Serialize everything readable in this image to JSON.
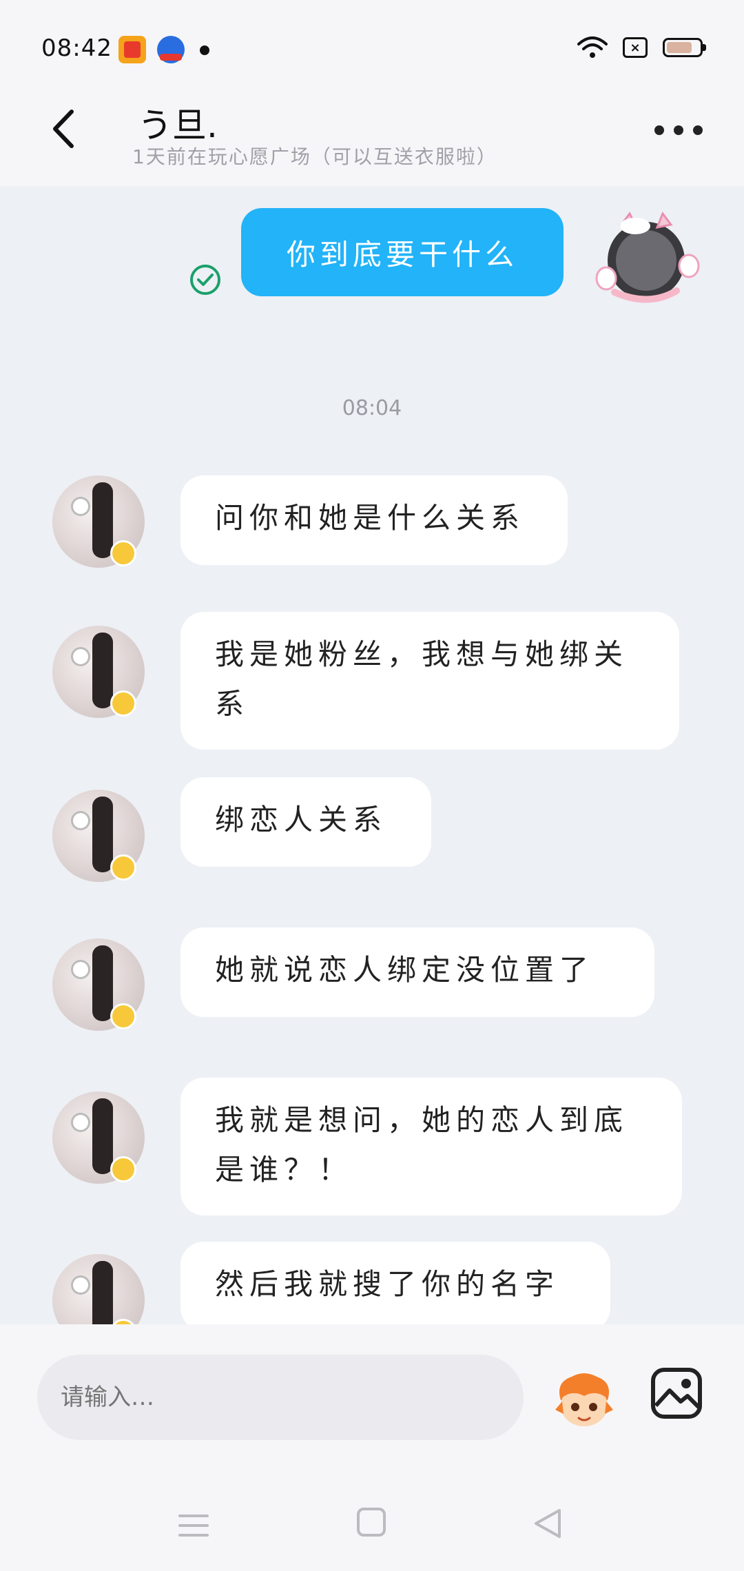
{
  "status_bar": {
    "time": "08:42"
  },
  "header": {
    "title": "う旦.",
    "subtitle": "1天前在玩心愿广场（可以互送衣服啦）"
  },
  "messages_out": [
    {
      "text": "你到底要干什么"
    }
  ],
  "timestamp": "08:04",
  "messages_in": [
    {
      "text": "问你和她是什么关系"
    },
    {
      "text": "我是她粉丝，我想与她绑关系"
    },
    {
      "text": "绑恋人关系"
    },
    {
      "text": "她就说恋人绑定没位置了"
    },
    {
      "text": "我就是想问，她的恋人到底是谁？！"
    },
    {
      "text": "然后我就搜了你的名字"
    }
  ],
  "input": {
    "placeholder": "请输入…"
  },
  "colors": {
    "outgoing_bubble": "#22b3f8",
    "incoming_bubble": "#ffffff",
    "chat_background": "#edf0f5",
    "sent_check": "#1aa06a"
  },
  "icons": [
    "back-arrow-icon",
    "more-icon",
    "sent-check-icon",
    "emoji-mascot-icon",
    "image-icon",
    "wifi-icon",
    "battery-icon"
  ]
}
